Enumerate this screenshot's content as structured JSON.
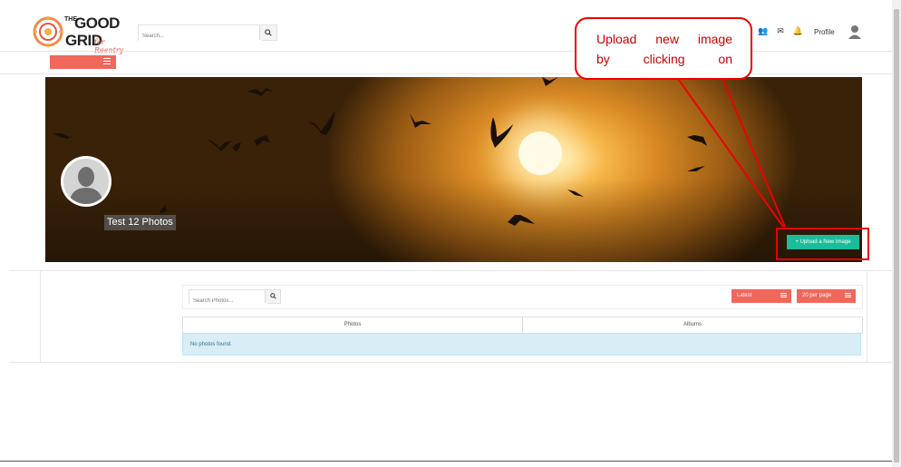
{
  "brand": {
    "logo_the": "THE",
    "logo_good": "GOOD",
    "logo_grid": "GRID",
    "logo_tagline": "for Reentry",
    "stripe_colors": [
      "#1e5fa8",
      "#2aa3d8",
      "#34b36a",
      "#1f7a3a"
    ]
  },
  "header": {
    "search_placeholder": "Search...",
    "search_icon": "search-icon",
    "icons": [
      "users-icon",
      "envelope-icon",
      "bell-icon"
    ],
    "profile_label": "Profile"
  },
  "cover": {
    "title": "Test 12 Photos",
    "upload_label": "Upload a New Image",
    "upload_color": "#1bbc9b"
  },
  "annotation": {
    "line1": "Upload new image",
    "line2": "by clicking on",
    "color": "#e00000"
  },
  "photos": {
    "search_placeholder": "Search Photos...",
    "sort_label": "Latest",
    "per_page_label": "20 per page",
    "tabs": [
      "Photos",
      "Albums"
    ],
    "empty_message": "No photos found.",
    "accent": "#f0675b"
  }
}
